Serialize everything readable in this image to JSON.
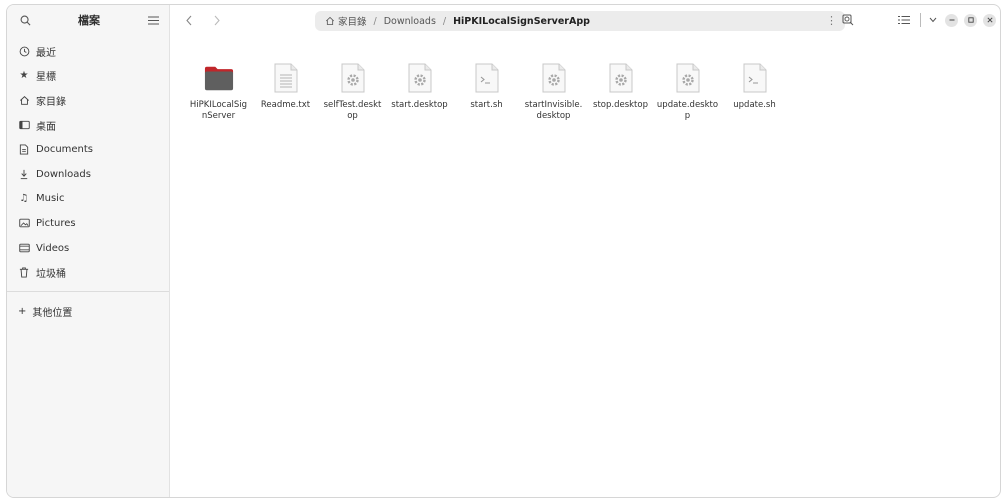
{
  "sidebar": {
    "title": "檔案",
    "items": [
      {
        "label": "最近",
        "icon": "clock-icon"
      },
      {
        "label": "星標",
        "icon": "star-icon"
      },
      {
        "label": "家目錄",
        "icon": "home-icon"
      },
      {
        "label": "桌面",
        "icon": "desktop-icon"
      },
      {
        "label": "Documents",
        "icon": "document-icon"
      },
      {
        "label": "Downloads",
        "icon": "download-icon"
      },
      {
        "label": "Music",
        "icon": "music-icon"
      },
      {
        "label": "Pictures",
        "icon": "picture-icon"
      },
      {
        "label": "Videos",
        "icon": "video-icon"
      },
      {
        "label": "垃圾桶",
        "icon": "trash-icon"
      }
    ],
    "other_locations": "其他位置"
  },
  "pathbar": {
    "home": "家目錄",
    "downloads": "Downloads",
    "current": "HiPKILocalSignServerApp"
  },
  "files": [
    {
      "name": "HiPKILocalSignServer",
      "type": "folder"
    },
    {
      "name": "Readme.txt",
      "type": "text"
    },
    {
      "name": "selfTest.desktop",
      "type": "desktop"
    },
    {
      "name": "start.desktop",
      "type": "desktop"
    },
    {
      "name": "start.sh",
      "type": "script"
    },
    {
      "name": "startInvisible.desktop",
      "type": "desktop"
    },
    {
      "name": "stop.desktop",
      "type": "desktop"
    },
    {
      "name": "update.desktop",
      "type": "desktop"
    },
    {
      "name": "update.sh",
      "type": "script"
    }
  ]
}
